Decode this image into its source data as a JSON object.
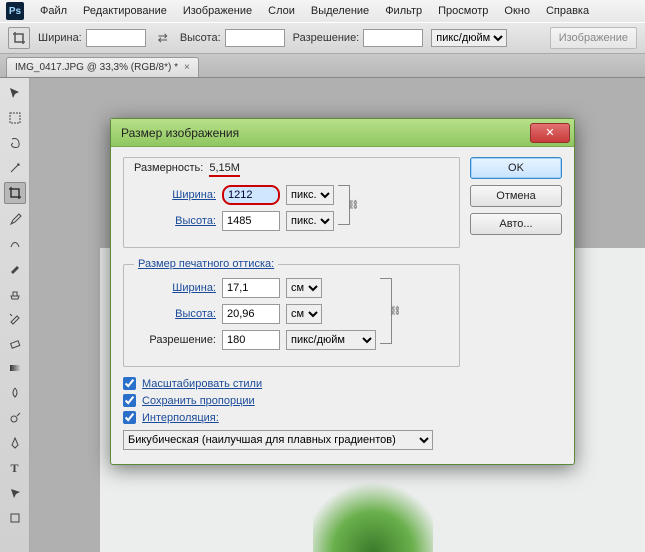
{
  "menubar": {
    "items": [
      "Файл",
      "Редактирование",
      "Изображение",
      "Слои",
      "Выделение",
      "Фильтр",
      "Просмотр",
      "Окно",
      "Справка"
    ]
  },
  "optionsbar": {
    "width_label": "Ширина:",
    "height_label": "Высота:",
    "resolution_label": "Разрешение:",
    "res_unit": "пикс/дюйм",
    "image_btn": "Изображение"
  },
  "tabs": {
    "doc": "IMG_0417.JPG @ 33,3% (RGB/8*) *"
  },
  "dialog": {
    "title": "Размер изображения",
    "ok": "OK",
    "cancel": "Отмена",
    "auto": "Авто...",
    "dim_legend": "Размерность:",
    "dim_size": "5,15M",
    "width_label": "Ширина:",
    "height_label": "Высота:",
    "width_val": "1212",
    "height_val": "1485",
    "px_unit": "пикс.",
    "print_legend": "Размер печатного оттиска:",
    "pwidth_val": "17,1",
    "pheight_val": "20,96",
    "cm_unit": "см",
    "res_label": "Разрешение:",
    "res_val": "180",
    "res_unit": "пикс/дюйм",
    "chk_scale": "Масштабировать стили",
    "chk_constrain": "Сохранить пропорции",
    "chk_interp": "Интерполяция:",
    "interp_method": "Бикубическая (наилучшая для плавных градиентов)"
  }
}
